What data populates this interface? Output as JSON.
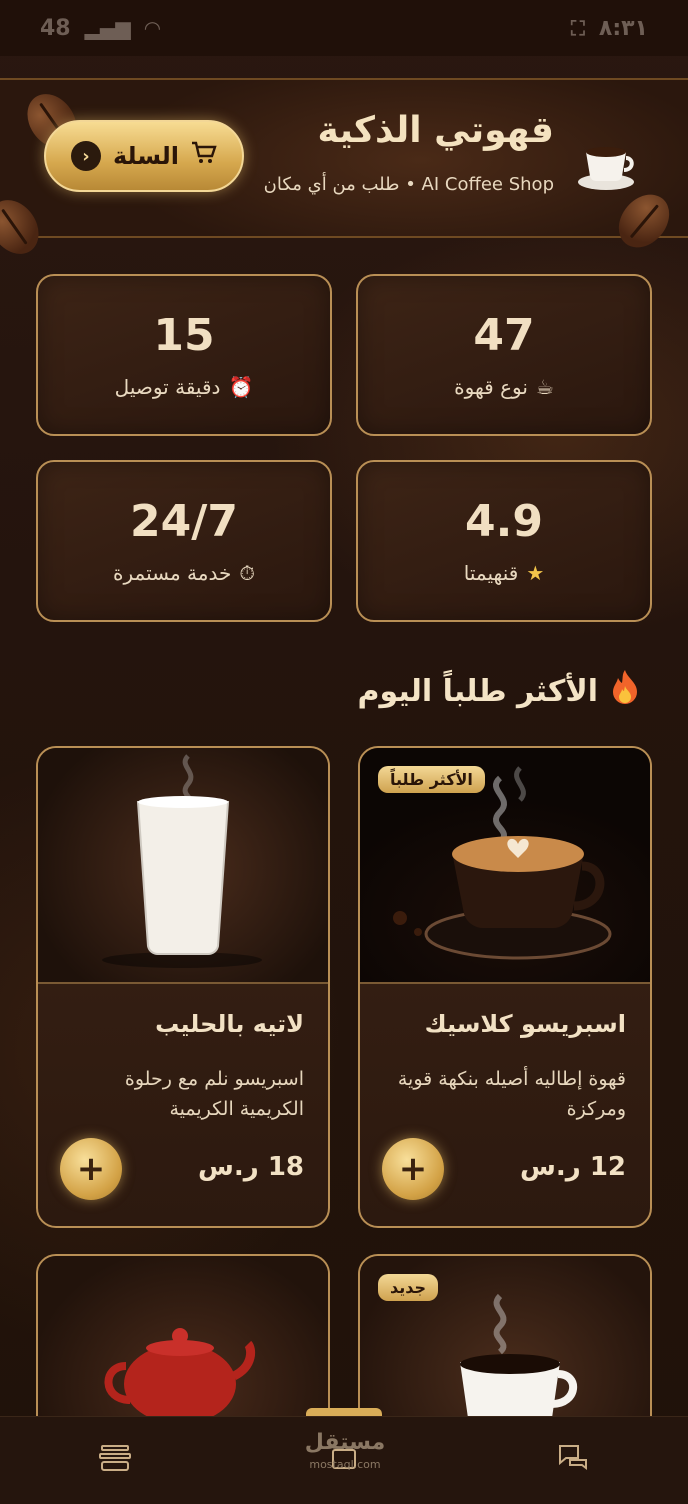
{
  "status_bar": {
    "time": "٨:٣١",
    "battery": "48"
  },
  "header": {
    "title": "قهوتي الذكية",
    "subtitle": "AI Coffee Shop • طلب من أي مكان",
    "cart_label": "السلة"
  },
  "stats": [
    {
      "value": "47",
      "label": "نوع قهوة",
      "icon": "coffee-cup-icon"
    },
    {
      "value": "15",
      "label": "دقيقة توصيل",
      "icon": "alarm-clock-icon"
    },
    {
      "value": "4.9",
      "label": "قنهيمتا",
      "icon": "star-icon"
    },
    {
      "value": "24/7",
      "label": "خدمة مستمرة",
      "icon": "stopwatch-icon"
    }
  ],
  "section": {
    "title": "الأكثر طلباً اليوم",
    "icon": "fire-icon"
  },
  "products": [
    {
      "name": "اسبريسو كلاسيك",
      "desc": "قهوة إطاليه أصيله بنكهة قوية ومركزة",
      "price": "12 ر.س",
      "badge": "الأكثر طلباً"
    },
    {
      "name": "لاتيه بالحليب",
      "desc": "اسبريسو نلم مع رحلوة الكريمية الكريمية",
      "price": "18 ر.س",
      "badge": ""
    },
    {
      "name": "",
      "desc": "",
      "price": "",
      "badge": "جديد"
    },
    {
      "name": "",
      "desc": "",
      "price": "",
      "badge": ""
    }
  ],
  "nav": {
    "watermark": "مستقل",
    "watermark_sub": "mostaql.com"
  },
  "colors": {
    "accent_gold": "#d6a84e",
    "background": "#24140d",
    "card_border": "#b98f55"
  }
}
